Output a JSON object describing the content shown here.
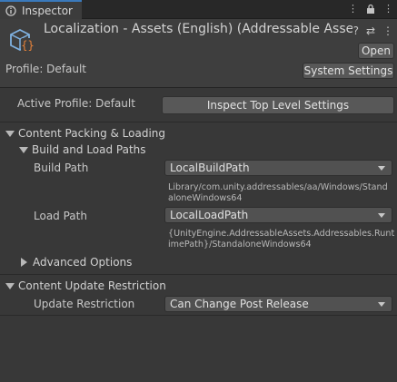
{
  "tab": {
    "title": "Inspector",
    "icon": "info-icon"
  },
  "tab_icons": [
    "more-vert-icon",
    "lock-icon",
    "menu-icon"
  ],
  "header": {
    "title": "Localization - Assets (English) (Addressable Asset Gro",
    "icon": "addressable-group-icon",
    "header_icons": [
      "help-icon",
      "preset-icon",
      "context-menu-icon"
    ],
    "open_label": "Open",
    "profile_label": "Profile: Default",
    "system_settings_label": "System Settings"
  },
  "active_profile": {
    "label": "Active Profile: Default",
    "inspect_label": "Inspect Top Level Settings"
  },
  "content_packing": {
    "label": "Content Packing & Loading",
    "build_and_load": {
      "label": "Build and Load Paths",
      "build_path": {
        "label": "Build Path",
        "value": "LocalBuildPath",
        "resolved_line1": "Library/com.unity.addressables/aa/Windows/Stand",
        "resolved_line2": "aloneWindows64"
      },
      "load_path": {
        "label": "Load Path",
        "value": "LocalLoadPath",
        "resolved_line1": "{UnityEngine.AddressableAssets.Addressables.Runt",
        "resolved_line2": "imePath}/StandaloneWindows64"
      }
    },
    "advanced_label": "Advanced Options"
  },
  "content_update": {
    "label": "Content Update Restriction",
    "restriction_label": "Update Restriction",
    "restriction_value": "Can Change Post Release"
  },
  "colors": {
    "background": "#383838",
    "header": "#3e3e3e",
    "tab_accent": "#3a79bb",
    "button": "#585858",
    "dropdown": "#515151",
    "icon_blue": "#7fb1e0",
    "icon_orange": "#e8833a"
  }
}
